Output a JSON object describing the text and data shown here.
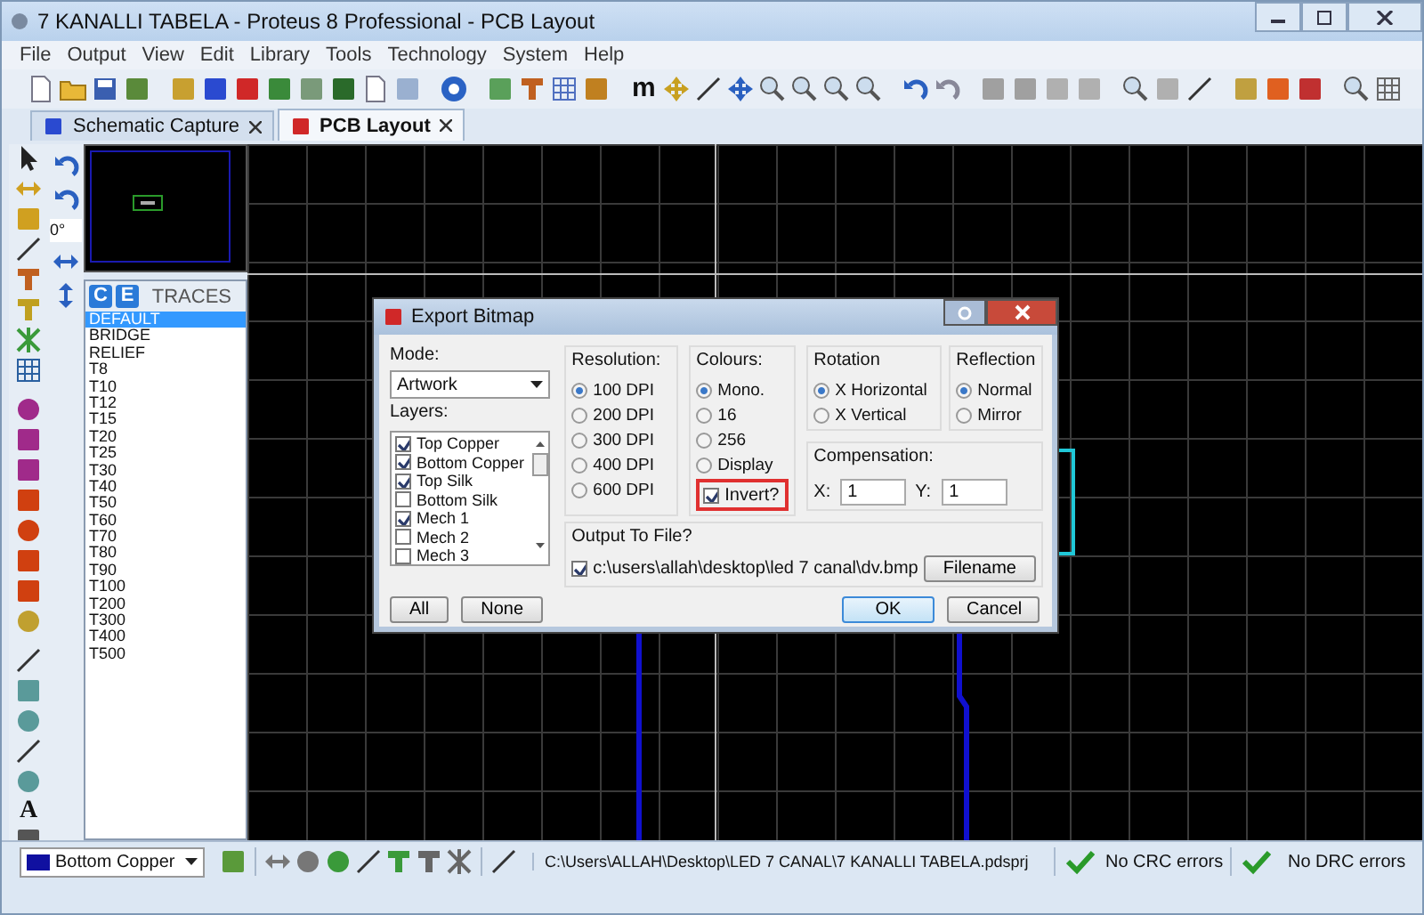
{
  "window": {
    "title": "7 KANALLI TABELA - Proteus 8 Professional - PCB Layout"
  },
  "menu": [
    "File",
    "Output",
    "View",
    "Edit",
    "Library",
    "Tools",
    "Technology",
    "System",
    "Help"
  ],
  "toolbar": {
    "glyph": "m"
  },
  "tabs": [
    {
      "label": "Schematic Capture",
      "selected": false
    },
    {
      "label": "PCB Layout",
      "selected": true
    }
  ],
  "side_tools": {
    "rotation": "0°",
    "text_glyph": "A"
  },
  "traces": {
    "title": "TRACES",
    "buttons": [
      "C",
      "E"
    ],
    "items": [
      {
        "label": "DEFAULT",
        "selected": true
      },
      {
        "label": "BRIDGE",
        "selected": false
      },
      {
        "label": "RELIEF",
        "selected": false
      },
      {
        "label": "T8",
        "selected": false
      },
      {
        "label": "T10",
        "selected": false
      },
      {
        "label": "T12",
        "selected": false
      },
      {
        "label": "T15",
        "selected": false
      },
      {
        "label": "T20",
        "selected": false
      },
      {
        "label": "T25",
        "selected": false
      },
      {
        "label": "T30",
        "selected": false
      },
      {
        "label": "T40",
        "selected": false
      },
      {
        "label": "T50",
        "selected": false
      },
      {
        "label": "T60",
        "selected": false
      },
      {
        "label": "T70",
        "selected": false
      },
      {
        "label": "T80",
        "selected": false
      },
      {
        "label": "T90",
        "selected": false
      },
      {
        "label": "T100",
        "selected": false
      },
      {
        "label": "T200",
        "selected": false
      },
      {
        "label": "T300",
        "selected": false
      },
      {
        "label": "T400",
        "selected": false
      },
      {
        "label": "T500",
        "selected": false
      }
    ]
  },
  "dialog": {
    "title": "Export Bitmap",
    "mode": {
      "label": "Mode:",
      "value": "Artwork"
    },
    "layers": {
      "label": "Layers:",
      "items": [
        {
          "label": "Top Copper",
          "checked": true
        },
        {
          "label": "Bottom Copper",
          "checked": true
        },
        {
          "label": "Top Silk",
          "checked": true
        },
        {
          "label": "Bottom Silk",
          "checked": false
        },
        {
          "label": "Mech 1",
          "checked": true
        },
        {
          "label": "Mech 2",
          "checked": false
        },
        {
          "label": "Mech 3",
          "checked": false
        }
      ]
    },
    "resolution": {
      "label": "Resolution:",
      "options": [
        {
          "label": "100 DPI",
          "selected": true
        },
        {
          "label": "200 DPI",
          "selected": false
        },
        {
          "label": "300 DPI",
          "selected": false
        },
        {
          "label": "400 DPI",
          "selected": false
        },
        {
          "label": "600 DPI",
          "selected": false
        }
      ]
    },
    "colours": {
      "label": "Colours:",
      "options": [
        {
          "label": "Mono.",
          "selected": true
        },
        {
          "label": "16",
          "selected": false
        },
        {
          "label": "256",
          "selected": false
        },
        {
          "label": "Display",
          "selected": false
        }
      ],
      "invert": {
        "label": "Invert?",
        "checked": true,
        "highlighted": true
      }
    },
    "rotation": {
      "label": "Rotation",
      "options": [
        {
          "label": "X Horizontal",
          "selected": true
        },
        {
          "label": "X Vertical",
          "selected": false
        }
      ]
    },
    "reflection": {
      "label": "Reflection",
      "options": [
        {
          "label": "Normal",
          "selected": true
        },
        {
          "label": "Mirror",
          "selected": false
        }
      ]
    },
    "compensation": {
      "label": "Compensation:",
      "x": {
        "label": "X:",
        "value": "1"
      },
      "y": {
        "label": "Y:",
        "value": "1"
      }
    },
    "output": {
      "label": "Output To File?",
      "checked": true,
      "path": "c:\\users\\allah\\desktop\\led 7  canal\\dv.bmp",
      "button": "Filename"
    },
    "buttons": [
      {
        "label": "All",
        "kind": "normal"
      },
      {
        "label": "None",
        "kind": "normal"
      },
      {
        "label": "OK",
        "kind": "default"
      },
      {
        "label": "Cancel",
        "kind": "normal"
      }
    ]
  },
  "status_bar": {
    "layer": "Bottom Copper",
    "path": "C:\\Users\\ALLAH\\Desktop\\LED 7  CANAL\\7 KANALLI TABELA.pdsprj",
    "crc": "No CRC errors",
    "drc": "No DRC errors"
  }
}
